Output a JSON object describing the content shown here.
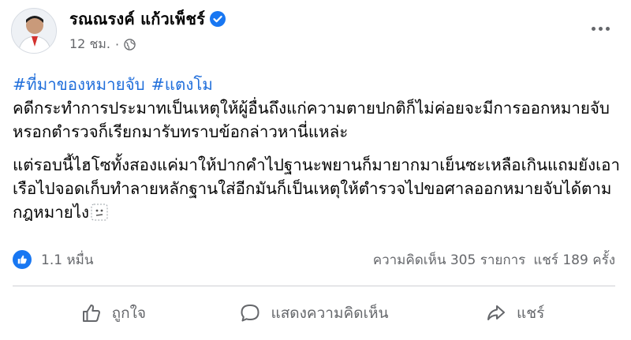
{
  "post": {
    "author": "รณณรงค์ แก้วเพ็ชร์",
    "time": "12 ชม.",
    "hashtags": [
      "#ที่มาของหมายจับ",
      "#แตงโม"
    ],
    "paragraphs": [
      "คดีกระทำการประมาทเป็นเหตุให้ผู้อื่นถึงแก่ความตายปกติก็ไม่ค่อยจะมีการออกหมายจับหรอกตำรวจก็เรียกมารับทราบข้อกล่าวหานี่แหล่ะ",
      "แต่รอบนี้ไฮโซทั้งสองแค่มาให้ปากคำไปฐานะพยานก็มายากมาเย็นซะเหลือเกินแถมยังเอาเรือไปจอดเก็บทำลายหลักฐานใส่อีกมันก็เป็นเหตุให้ตำรวจไปขอศาลออกหมายจับได้ตามกฎหมายไง"
    ]
  },
  "stats": {
    "reactions_count": "1.1 หมื่น",
    "comments": "ความคิดเห็น 305 รายการ",
    "shares": "แชร์ 189 ครั้ง"
  },
  "actions": {
    "like": "ถูกใจ",
    "comment": "แสดงความคิดเห็น",
    "share": "แชร์"
  },
  "colors": {
    "hashtag": "#216fdb",
    "verified_badge": "#1877f2",
    "like_badge": "#1877f2",
    "meta_text": "#65676b"
  },
  "icons": {
    "verified": "verified-check-icon",
    "privacy": "globe-icon",
    "more": "more-dots-icon",
    "reaction": "like-reaction-icon",
    "like_action": "thumbs-up-icon",
    "comment_action": "comment-bubble-icon",
    "share_action": "share-arrow-icon",
    "inline_emoji": "thinking-emoji-icon"
  }
}
